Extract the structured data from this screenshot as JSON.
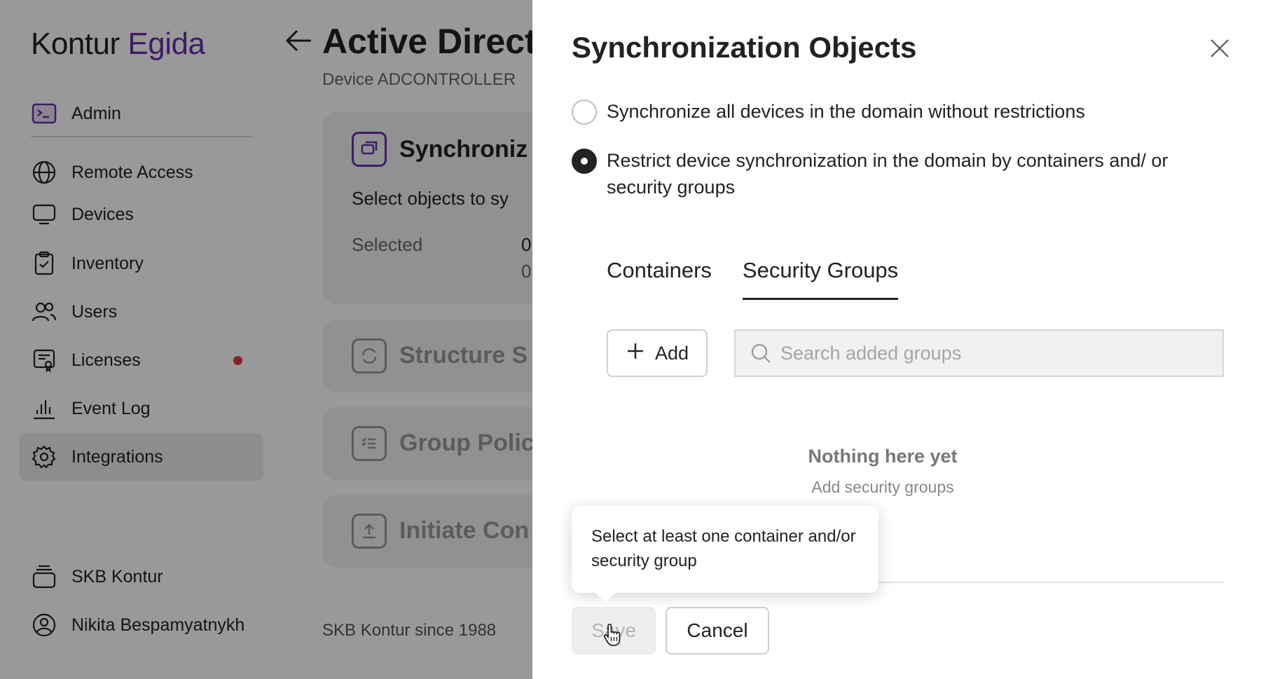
{
  "sidebar": {
    "logo_part1": "Kontur",
    "logo_part2": "Egida",
    "admin_label": "Admin",
    "items": [
      {
        "label": "Remote Access"
      },
      {
        "label": "Devices"
      },
      {
        "label": "Inventory"
      },
      {
        "label": "Users"
      },
      {
        "label": "Licenses"
      },
      {
        "label": "Event Log"
      },
      {
        "label": "Integrations"
      }
    ],
    "bottom_items": [
      {
        "label": "SKB Kontur"
      },
      {
        "label": "Nikita Bespamyatnykh"
      }
    ]
  },
  "main": {
    "title": "Active Direct",
    "subtitle": "Device ADCONTROLLER",
    "cards": [
      {
        "title": "Synchroniz",
        "text": "Select objects to sy",
        "selected_label": "Selected",
        "value1": "0",
        "value2": "0"
      },
      {
        "title": "Structure S"
      },
      {
        "title": "Group Polic"
      },
      {
        "title": "Initiate Con"
      }
    ],
    "footer": "SKB Kontur since 1988"
  },
  "modal": {
    "title": "Synchronization Objects",
    "option_all": "Synchronize all devices in the domain without restrictions",
    "option_restrict": "Restrict device synchronization in the domain by containers and/ or security groups",
    "tabs": [
      {
        "label": "Containers"
      },
      {
        "label": "Security Groups"
      }
    ],
    "add_label": "Add",
    "search_placeholder": "Search added groups",
    "empty_title": "Nothing here yet",
    "empty_subtitle": "Add security groups",
    "tooltip": "Select at least one container and/or security group",
    "save_label": "Save",
    "cancel_label": "Cancel"
  },
  "colors": {
    "accent": "#6a2fb0",
    "badge": "#e53935"
  }
}
